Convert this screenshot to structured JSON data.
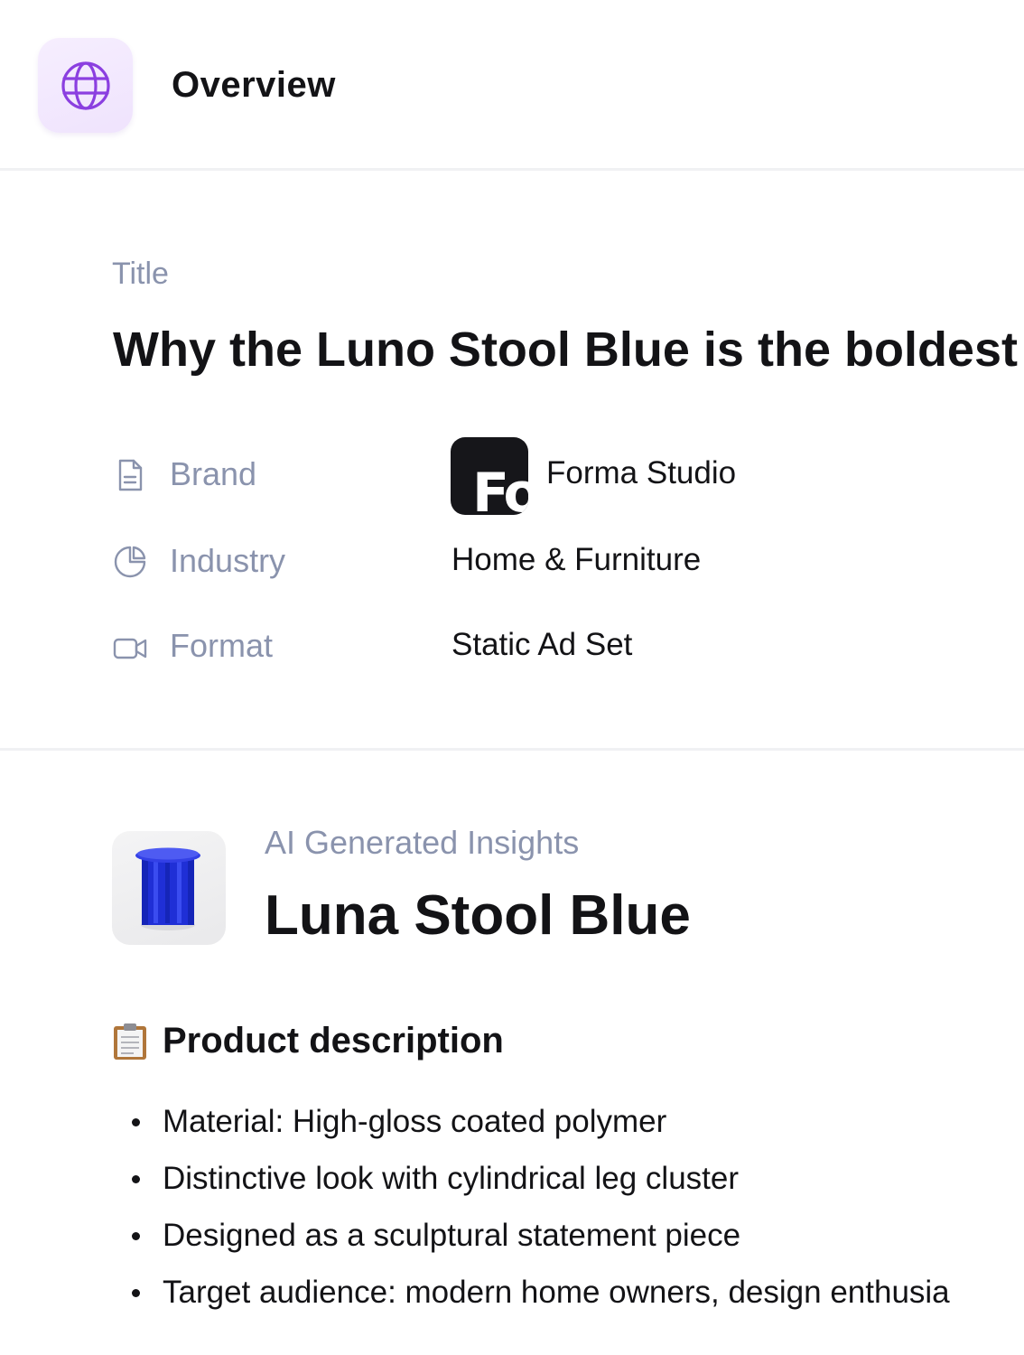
{
  "header": {
    "icon": "globe-icon",
    "title": "Overview"
  },
  "title_section": {
    "label": "Title",
    "value": "Why the Luno Stool Blue is the boldest pi"
  },
  "meta": {
    "brand": {
      "icon": "document-icon",
      "label": "Brand",
      "logo_text": "Fo",
      "value": "Forma Studio"
    },
    "industry": {
      "icon": "pie-chart-icon",
      "label": "Industry",
      "value": "Home & Furniture"
    },
    "format": {
      "icon": "video-camera-icon",
      "label": "Format",
      "value": "Static Ad Set"
    }
  },
  "insights": {
    "label": "AI Generated Insights",
    "product_name": "Luna Stool Blue",
    "description_heading": "Product description",
    "description_icon": "clipboard-icon",
    "bullets": [
      "Material: High-gloss coated polymer",
      "Distinctive look with cylindrical leg cluster",
      "Designed as a sculptural statement piece",
      "Target audience: modern home owners, design enthusia"
    ]
  },
  "colors": {
    "accent": "#8b3fe0",
    "label_gray": "#8a93ad",
    "text": "#131316",
    "product_blue": "#1f2fd6"
  }
}
